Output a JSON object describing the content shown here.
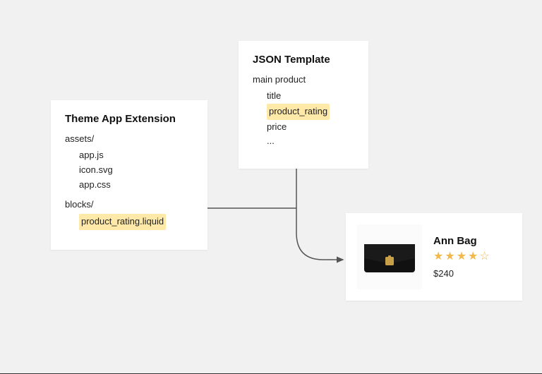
{
  "extension_card": {
    "title": "Theme App Extension",
    "assets_label": "assets/",
    "assets": [
      "app.js",
      "icon.svg",
      "app.css"
    ],
    "blocks_label": "blocks/",
    "block_highlight": "product_rating.liquid"
  },
  "json_card": {
    "title": "JSON Template",
    "root_label": "main product",
    "fields": [
      "title",
      "product_rating",
      "price",
      "..."
    ],
    "highlight_field": "product_rating"
  },
  "product_card": {
    "name": "Ann Bag",
    "rating": 4,
    "rating_max": 5,
    "price": "$240"
  }
}
